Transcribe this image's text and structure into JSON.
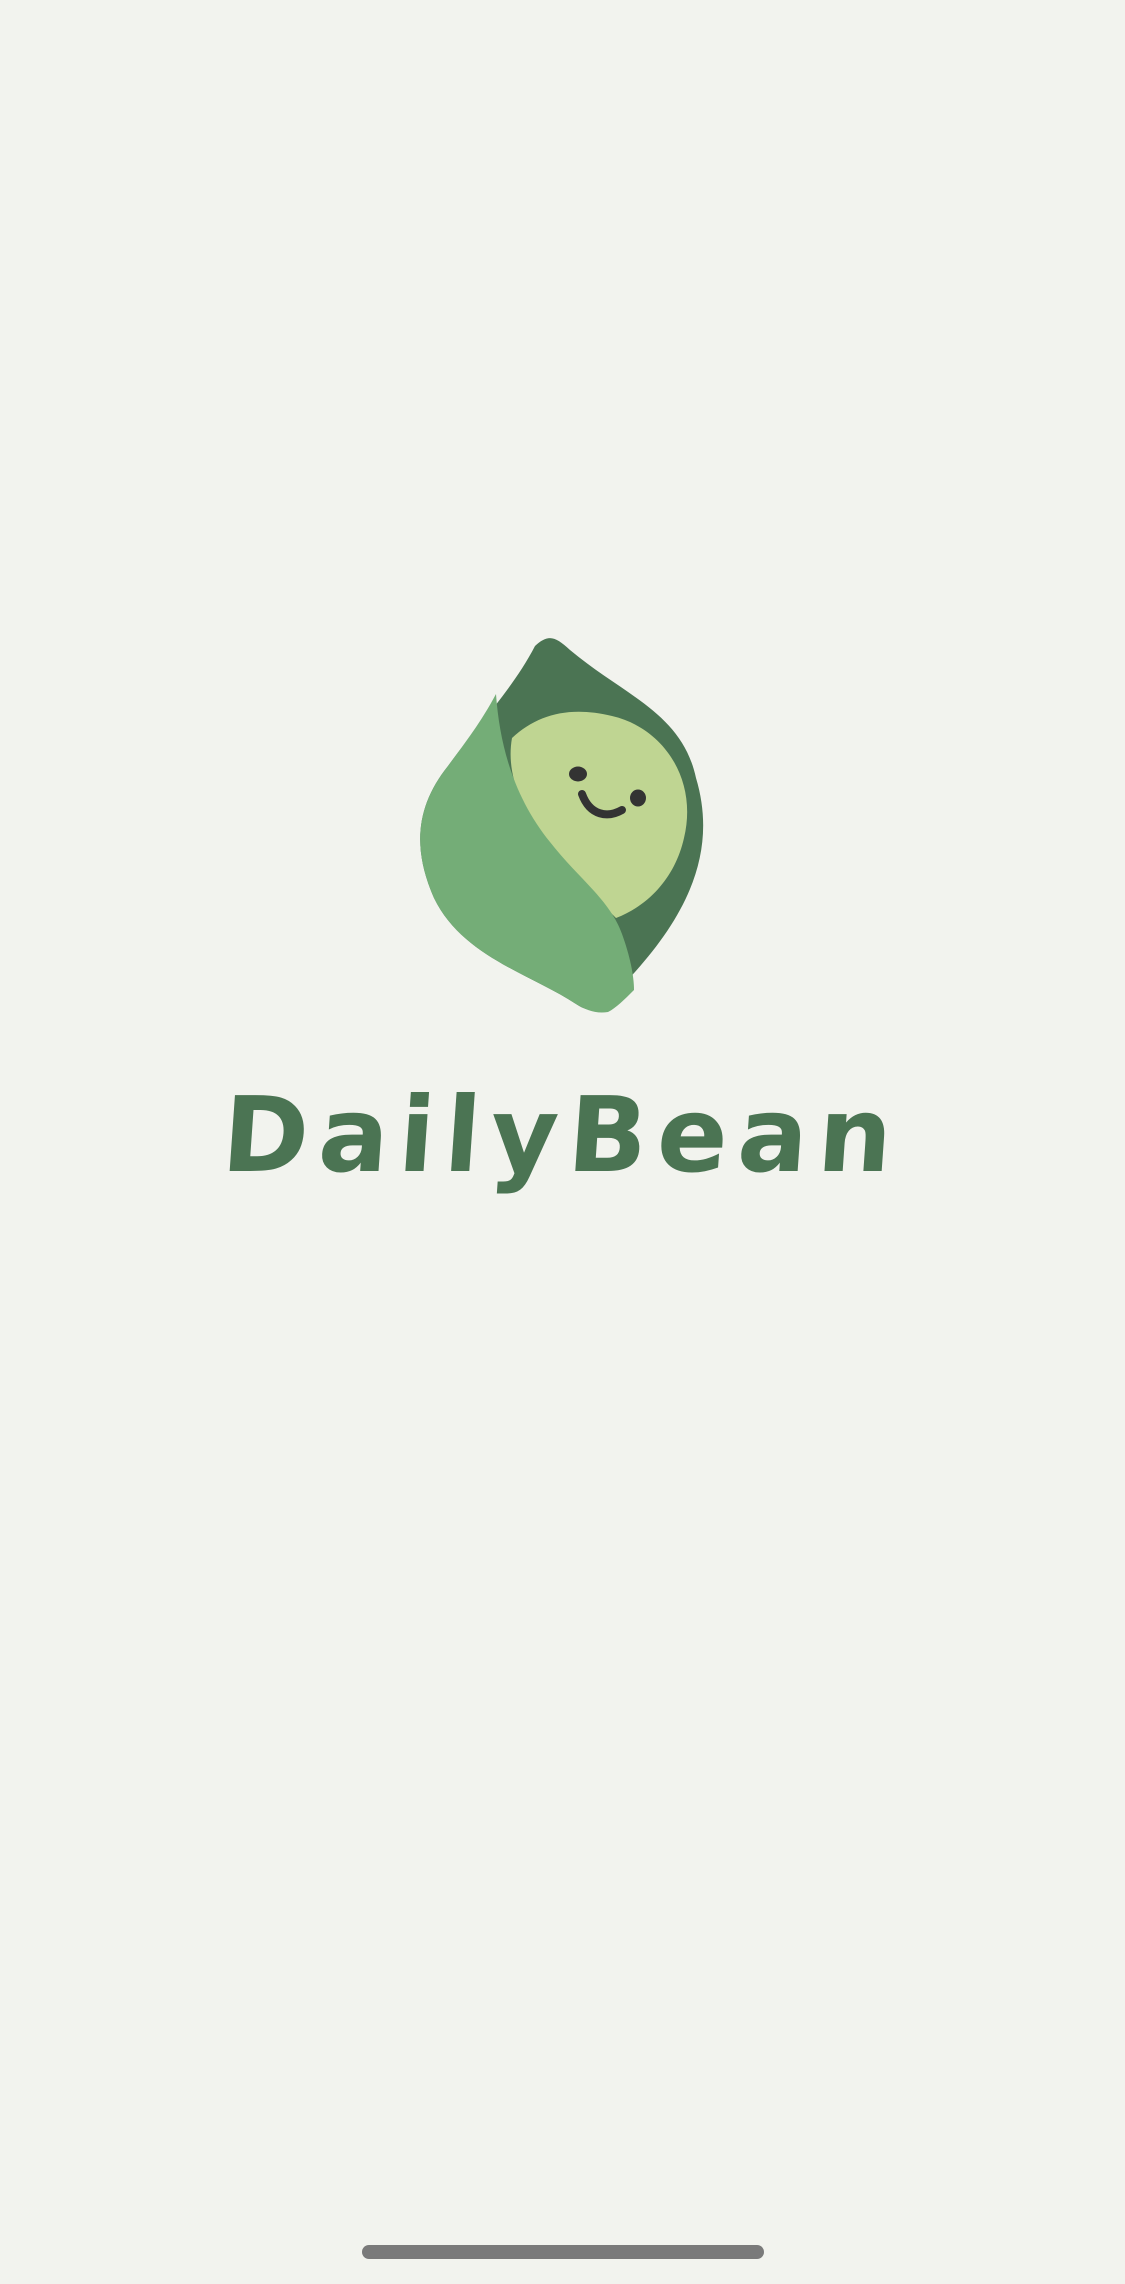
{
  "app": {
    "name": "DailyBean"
  },
  "colors": {
    "background": "#F2F3EE",
    "brand_dark_green": "#4B7453",
    "leaf_green": "#74AD77",
    "bean_light_green": "#BFD592",
    "face": "#333333",
    "home_indicator": "#7A7A7A"
  },
  "icons": {
    "logo": "bean-in-pod-logo"
  }
}
